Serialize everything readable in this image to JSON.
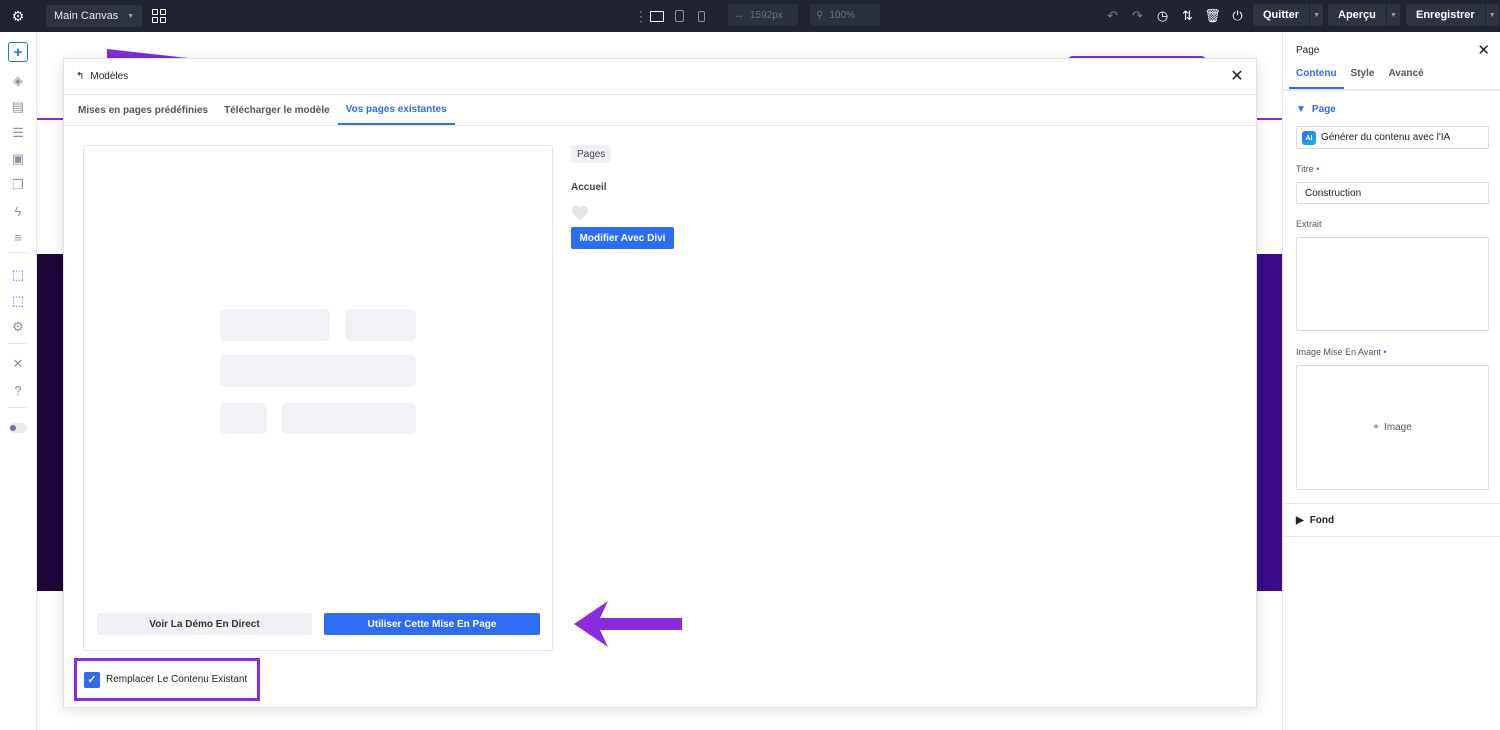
{
  "topbar": {
    "canvas_name": "Main Canvas",
    "width_value": "1592px",
    "zoom_value": "100%",
    "quit_label": "Quitter",
    "preview_label": "Aperçu",
    "save_label": "Enregistrer"
  },
  "modal": {
    "title": "Modèles",
    "tabs": [
      {
        "label": "Mises en pages prédéfinies"
      },
      {
        "label": "Télécharger le modèle"
      },
      {
        "label": "Vos pages existantes"
      }
    ],
    "demo_button": "Voir La Démo En Direct",
    "use_button": "Utiliser Cette Mise En Page",
    "pages_badge": "Pages",
    "page_name": "Accueil",
    "modify_button": "Modifier Avec Divi",
    "replace_label": "Remplacer Le Contenu Existant",
    "replace_checked": true
  },
  "right_panel": {
    "title": "Page",
    "tabs": [
      {
        "label": "Contenu"
      },
      {
        "label": "Style"
      },
      {
        "label": "Avancé"
      }
    ],
    "section_page": "Page",
    "ai_badge": "AI",
    "ai_button": "Générer du contenu avec l'IA",
    "title_label": "Titre",
    "title_value": "Construction",
    "excerpt_label": "Extrait",
    "featured_label": "Image Mise En Avant",
    "image_label": "Image",
    "section_fond": "Fond"
  },
  "colors": {
    "accent": "#2d6cf6",
    "highlight": "#8a2be2",
    "topbar_bg": "#1f2430"
  }
}
